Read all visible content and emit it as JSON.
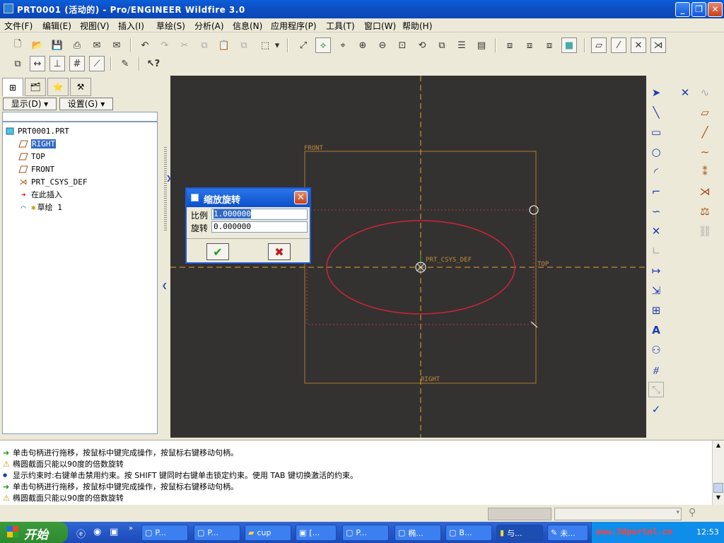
{
  "window": {
    "title": "PRT0001 (活动的) - Pro/ENGINEER Wildfire 3.0",
    "minimize": "_",
    "maximize": "❐",
    "close": "✕"
  },
  "menu": [
    "文件(F)",
    "编辑(E)",
    "视图(V)",
    "插入(I)",
    "草绘(S)",
    "分析(A)",
    "信息(N)",
    "应用程序(P)",
    "工具(T)",
    "窗口(W)",
    "帮助(H)"
  ],
  "nav": {
    "show_btn": "显示(D) ▾",
    "settings_btn": "设置(G) ▾"
  },
  "tree": {
    "root": "PRT0001.PRT",
    "items": [
      "RIGHT",
      "TOP",
      "FRONT",
      "PRT_CSYS_DEF",
      "在此插入",
      "草绘 1"
    ],
    "selected_index": 0
  },
  "canvas": {
    "label_front": "FRONT",
    "label_top": "TOP",
    "label_right": "RIGHT",
    "label_csys": "PRT_CSYS_DEF"
  },
  "dialog": {
    "title": "缩放旋转",
    "scale_label": "比例",
    "scale_value": "1.000000",
    "rotate_label": "旋转",
    "rotate_value": "0.000000",
    "ok": "✔",
    "cancel": "✖",
    "close": "✕"
  },
  "messages": [
    {
      "icon": "➜",
      "color": "#1a9a1a",
      "text": "单击句柄进行拖移，按鼠标中键完成操作，按鼠标右键移动句柄。"
    },
    {
      "icon": "⚠",
      "color": "#c89a00",
      "text": "椭圆截面只能以90度的倍数旋转"
    },
    {
      "icon": "●",
      "color": "#1a3bb5",
      "text": "显示约束时:右键单击禁用约束。按 SHIFT 键同时右键单击锁定约束。使用 TAB 键切换激活的约束。"
    },
    {
      "icon": "➜",
      "color": "#1a9a1a",
      "text": "单击句柄进行拖移，按鼠标中键完成操作，按鼠标右键移动句柄。"
    },
    {
      "icon": "⚠",
      "color": "#c89a00",
      "text": "椭圆截面只能以90度的倍数旋转"
    }
  ],
  "taskbar": {
    "start": "开始",
    "tasks": [
      "P...",
      "P...",
      "cup",
      "[...",
      "P...",
      "椭...",
      "B...",
      "与...",
      "未..."
    ],
    "watermark": "www.3dportal.cn",
    "clock": "12:53"
  },
  "colors": {
    "canvas_bg": "#333230",
    "datum": "#c08a3c",
    "sketch": "#d0233a",
    "axis": "#e8a23a"
  }
}
